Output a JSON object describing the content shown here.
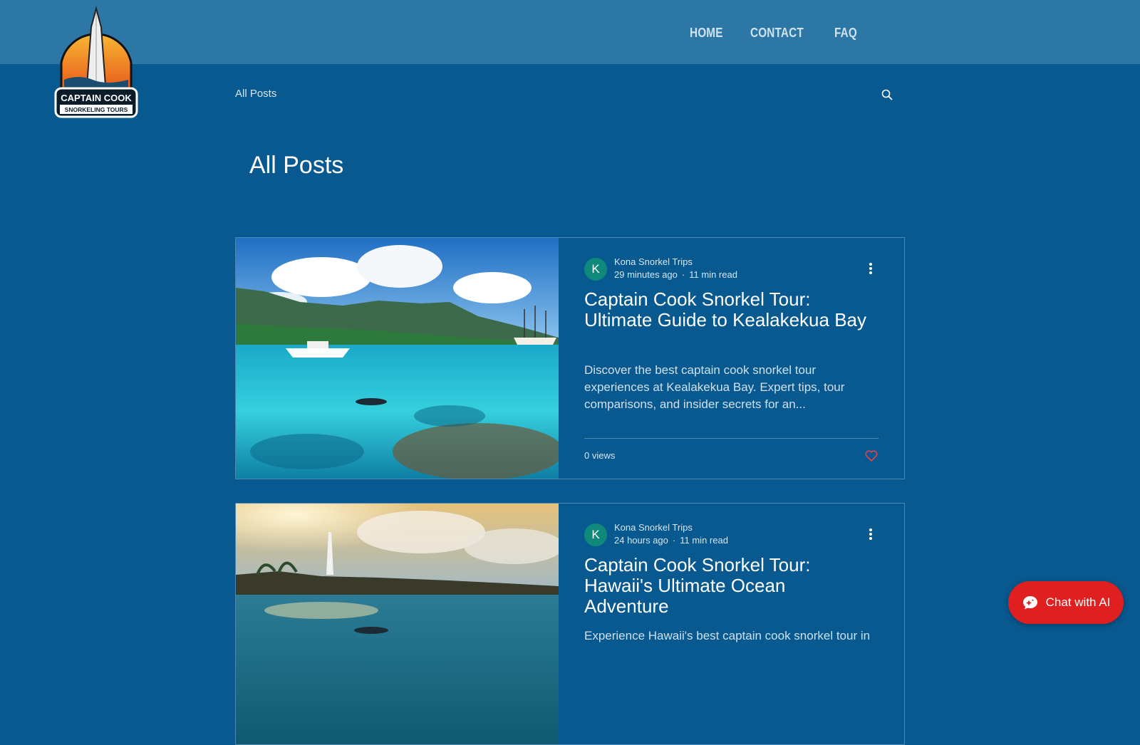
{
  "header": {
    "nav": [
      "HOME",
      "CONTACT",
      "FAQ"
    ],
    "logo_text": [
      "CAPTAIN COOK",
      "SNORKELING TOURS"
    ]
  },
  "blog_nav": {
    "label": "All Posts"
  },
  "page_title": "All Posts",
  "posts": [
    {
      "avatar_letter": "K",
      "author": "Kona Snorkel Trips",
      "time": "29 minutes ago",
      "read_time": "11 min read",
      "title": "Captain Cook Snorkel Tour: Ultimate Guide to Kealakekua Bay",
      "excerpt": "Discover the best captain cook snorkel tour experiences at Kealakekua Bay. Expert tips, tour comparisons, and insider secrets for an...",
      "views": "0 views"
    },
    {
      "avatar_letter": "K",
      "author": "Kona Snorkel Trips",
      "time": "24 hours ago",
      "read_time": "11 min read",
      "title": "Captain Cook Snorkel Tour: Hawaii's Ultimate Ocean Adventure",
      "excerpt": "Experience Hawaii's best captain cook snorkel tour in",
      "views": ""
    }
  ],
  "chat": {
    "label": "Chat with AI"
  },
  "colors": {
    "background": "#07598f",
    "header": "#2c77a6",
    "chat_button": "#e02020",
    "avatar": "#0f8a7a"
  }
}
